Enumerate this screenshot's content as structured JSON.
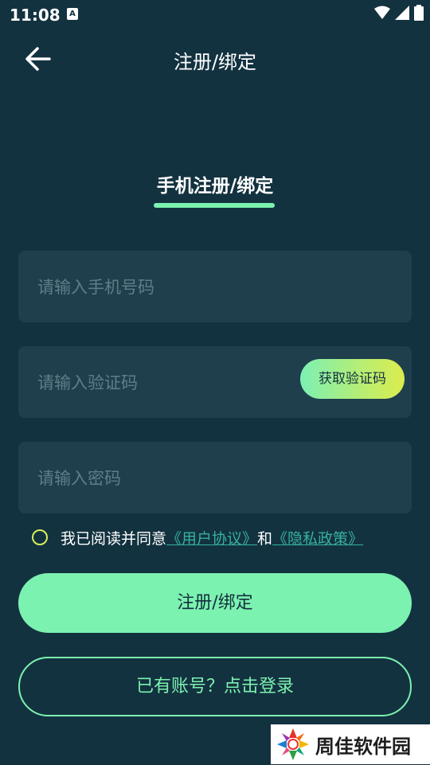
{
  "status_bar": {
    "time": "11:08",
    "notification_glyph": "A"
  },
  "header": {
    "title": "注册/绑定"
  },
  "tab": {
    "label": "手机注册/绑定"
  },
  "form": {
    "phone_placeholder": "请输入手机号码",
    "code_placeholder": "请输入验证码",
    "get_code_label": "获取验证码",
    "password_placeholder": "请输入密码"
  },
  "agreement": {
    "prefix": "我已阅读并同意",
    "user_agreement": "《用户协议》",
    "and": "和",
    "privacy_policy": "《隐私政策》"
  },
  "buttons": {
    "register": "注册/绑定",
    "login": "已有账号？点击登录"
  },
  "watermark": {
    "text": "周佳软件园"
  },
  "colors": {
    "background": "#133240",
    "accent": "#7cf2b0",
    "field": "#1f3f4d",
    "link": "#35b0a0"
  }
}
